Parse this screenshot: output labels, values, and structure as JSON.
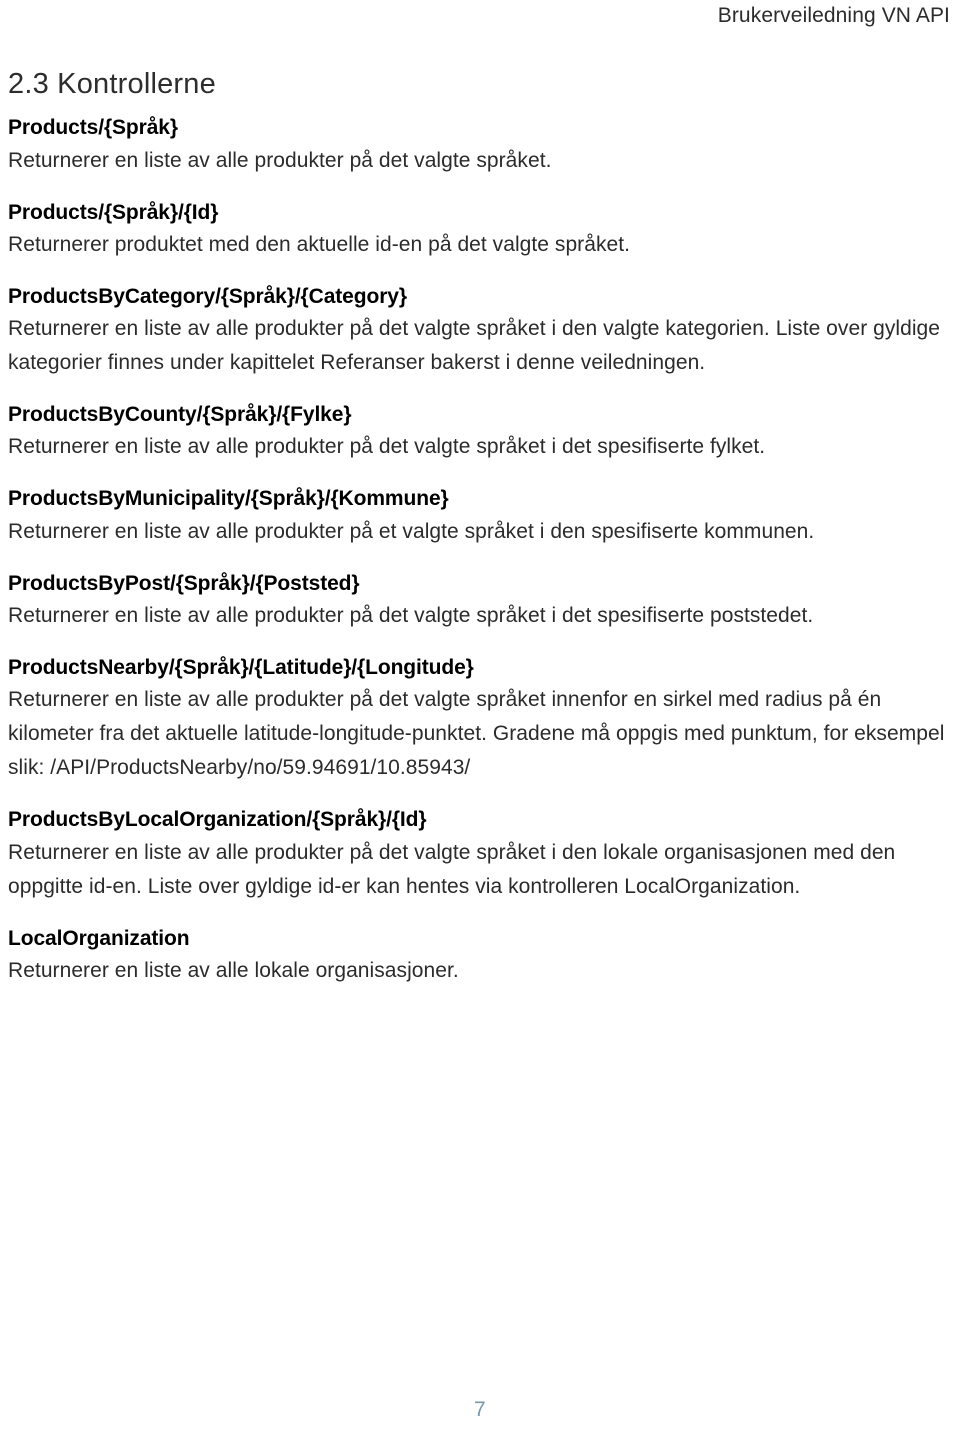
{
  "header": {
    "running_title": "Brukerveiledning VN API"
  },
  "section": {
    "number": "2.3",
    "title": "2.3 Kontrollerne"
  },
  "endpoints": [
    {
      "name": "Products/{Språk}",
      "description": "Returnerer en liste av alle produkter på det valgte språket."
    },
    {
      "name": "Products/{Språk}/{Id}",
      "description": "Returnerer produktet med den aktuelle id-en på det valgte språket."
    },
    {
      "name": "ProductsByCategory/{Språk}/{Category}",
      "description": "Returnerer en liste av alle produkter på det valgte språket i den valgte kategorien. Liste over gyldige kategorier finnes under kapittelet Referanser bakerst i denne veiledningen."
    },
    {
      "name": "ProductsByCounty/{Språk}/{Fylke}",
      "description": "Returnerer en liste av alle produkter på det valgte språket i det spesifiserte fylket."
    },
    {
      "name": "ProductsByMunicipality/{Språk}/{Kommune}",
      "description": "Returnerer en liste av alle produkter på et valgte språket i den spesifiserte kommunen."
    },
    {
      "name": "ProductsByPost/{Språk}/{Poststed}",
      "description": "Returnerer en liste av alle produkter på det valgte språket i det spesifiserte poststedet."
    },
    {
      "name": "ProductsNearby/{Språk}/{Latitude}/{Longitude}",
      "description": "Returnerer en liste av alle produkter på det valgte språket innenfor en sirkel med radius på én kilometer fra det aktuelle latitude-longitude-punktet. Gradene må oppgis med punktum, for eksempel slik: /API/ProductsNearby/no/59.94691/10.85943/"
    },
    {
      "name": "ProductsByLocalOrganization/{Språk}/{Id}",
      "description": "Returnerer en liste av alle produkter på det valgte språket i den lokale organisasjonen med den oppgitte id-en. Liste over gyldige id-er kan hentes via kontrolleren LocalOrganization."
    },
    {
      "name": "LocalOrganization",
      "description": "Returnerer en liste av alle lokale organisasjoner."
    }
  ],
  "footer": {
    "page_number": "7"
  },
  "colors": {
    "text": "#2b2b2b",
    "heading": "#2d2d2d",
    "endpoint_name": "#000000",
    "page_number": "#7a99ac",
    "background": "#ffffff"
  }
}
